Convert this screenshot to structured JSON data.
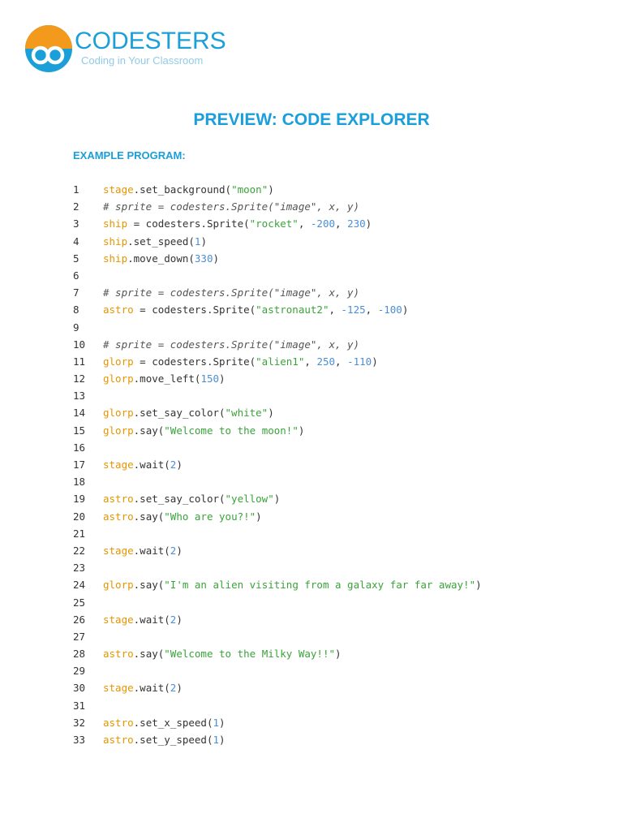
{
  "header": {
    "brand_name": "CODESTERS",
    "brand_tagline": "Coding in Your Classroom",
    "brand_colors": {
      "blue": "#1a9fd8",
      "orange": "#f39a1d"
    }
  },
  "document": {
    "title": "PREVIEW: CODE EXPLORER",
    "section_heading": "EXAMPLE PROGRAM:"
  },
  "code": {
    "colors": {
      "object": "#e59500",
      "string": "#3aa33a",
      "number": "#4a8fd6",
      "comment": "#555555",
      "plain": "#333333"
    },
    "lines": [
      {
        "num": "1",
        "tokens": [
          {
            "t": "stage",
            "c": "obj"
          },
          {
            "t": ".set_background(",
            "c": "plain"
          },
          {
            "t": "\"moon\"",
            "c": "str"
          },
          {
            "t": ")",
            "c": "plain"
          }
        ]
      },
      {
        "num": "2",
        "tokens": [
          {
            "t": "# sprite = codesters.Sprite(\"image\", x, y)",
            "c": "cmt"
          }
        ]
      },
      {
        "num": "3",
        "tokens": [
          {
            "t": "ship",
            "c": "obj"
          },
          {
            "t": " = codesters.Sprite(",
            "c": "plain"
          },
          {
            "t": "\"rocket\"",
            "c": "str"
          },
          {
            "t": ", ",
            "c": "plain"
          },
          {
            "t": "-200",
            "c": "num"
          },
          {
            "t": ", ",
            "c": "plain"
          },
          {
            "t": "230",
            "c": "num"
          },
          {
            "t": ")",
            "c": "plain"
          }
        ]
      },
      {
        "num": "4",
        "tokens": [
          {
            "t": "ship",
            "c": "obj"
          },
          {
            "t": ".set_speed(",
            "c": "plain"
          },
          {
            "t": "1",
            "c": "num"
          },
          {
            "t": ")",
            "c": "plain"
          }
        ]
      },
      {
        "num": "5",
        "tokens": [
          {
            "t": "ship",
            "c": "obj"
          },
          {
            "t": ".move_down(",
            "c": "plain"
          },
          {
            "t": "330",
            "c": "num"
          },
          {
            "t": ")",
            "c": "plain"
          }
        ]
      },
      {
        "num": "6",
        "tokens": []
      },
      {
        "num": "7",
        "tokens": [
          {
            "t": "# sprite = codesters.Sprite(\"image\", x, y)",
            "c": "cmt"
          }
        ]
      },
      {
        "num": "8",
        "tokens": [
          {
            "t": "astro",
            "c": "obj"
          },
          {
            "t": " = codesters.Sprite(",
            "c": "plain"
          },
          {
            "t": "\"astronaut2\"",
            "c": "str"
          },
          {
            "t": ", ",
            "c": "plain"
          },
          {
            "t": "-125",
            "c": "num"
          },
          {
            "t": ", ",
            "c": "plain"
          },
          {
            "t": "-100",
            "c": "num"
          },
          {
            "t": ")",
            "c": "plain"
          }
        ]
      },
      {
        "num": "9",
        "tokens": []
      },
      {
        "num": "10",
        "tokens": [
          {
            "t": "# sprite = codesters.Sprite(\"image\", x, y)",
            "c": "cmt"
          }
        ]
      },
      {
        "num": "11",
        "tokens": [
          {
            "t": "glorp",
            "c": "obj"
          },
          {
            "t": " = codesters.Sprite(",
            "c": "plain"
          },
          {
            "t": "\"alien1\"",
            "c": "str"
          },
          {
            "t": ", ",
            "c": "plain"
          },
          {
            "t": "250",
            "c": "num"
          },
          {
            "t": ", ",
            "c": "plain"
          },
          {
            "t": "-110",
            "c": "num"
          },
          {
            "t": ")",
            "c": "plain"
          }
        ]
      },
      {
        "num": "12",
        "tokens": [
          {
            "t": "glorp",
            "c": "obj"
          },
          {
            "t": ".move_left(",
            "c": "plain"
          },
          {
            "t": "150",
            "c": "num"
          },
          {
            "t": ")",
            "c": "plain"
          }
        ]
      },
      {
        "num": "13",
        "tokens": []
      },
      {
        "num": "14",
        "tokens": [
          {
            "t": "glorp",
            "c": "obj"
          },
          {
            "t": ".set_say_color(",
            "c": "plain"
          },
          {
            "t": "\"white\"",
            "c": "str"
          },
          {
            "t": ")",
            "c": "plain"
          }
        ]
      },
      {
        "num": "15",
        "tokens": [
          {
            "t": "glorp",
            "c": "obj"
          },
          {
            "t": ".say(",
            "c": "plain"
          },
          {
            "t": "\"Welcome to the moon!\"",
            "c": "str"
          },
          {
            "t": ")",
            "c": "plain"
          }
        ]
      },
      {
        "num": "16",
        "tokens": []
      },
      {
        "num": "17",
        "tokens": [
          {
            "t": "stage",
            "c": "obj"
          },
          {
            "t": ".wait(",
            "c": "plain"
          },
          {
            "t": "2",
            "c": "num"
          },
          {
            "t": ")",
            "c": "plain"
          }
        ]
      },
      {
        "num": "18",
        "tokens": []
      },
      {
        "num": "19",
        "tokens": [
          {
            "t": "astro",
            "c": "obj"
          },
          {
            "t": ".set_say_color(",
            "c": "plain"
          },
          {
            "t": "\"yellow\"",
            "c": "str"
          },
          {
            "t": ")",
            "c": "plain"
          }
        ]
      },
      {
        "num": "20",
        "tokens": [
          {
            "t": "astro",
            "c": "obj"
          },
          {
            "t": ".say(",
            "c": "plain"
          },
          {
            "t": "\"Who are you?!\"",
            "c": "str"
          },
          {
            "t": ")",
            "c": "plain"
          }
        ]
      },
      {
        "num": "21",
        "tokens": []
      },
      {
        "num": "22",
        "tokens": [
          {
            "t": "stage",
            "c": "obj"
          },
          {
            "t": ".wait(",
            "c": "plain"
          },
          {
            "t": "2",
            "c": "num"
          },
          {
            "t": ")",
            "c": "plain"
          }
        ]
      },
      {
        "num": "23",
        "tokens": []
      },
      {
        "num": "24",
        "tokens": [
          {
            "t": "glorp",
            "c": "obj"
          },
          {
            "t": ".say(",
            "c": "plain"
          },
          {
            "t": "\"I'm an alien visiting from a galaxy far far away!\"",
            "c": "str"
          },
          {
            "t": ")",
            "c": "plain"
          }
        ]
      },
      {
        "num": "25",
        "tokens": []
      },
      {
        "num": "26",
        "tokens": [
          {
            "t": "stage",
            "c": "obj"
          },
          {
            "t": ".wait(",
            "c": "plain"
          },
          {
            "t": "2",
            "c": "num"
          },
          {
            "t": ")",
            "c": "plain"
          }
        ]
      },
      {
        "num": "27",
        "tokens": []
      },
      {
        "num": "28",
        "tokens": [
          {
            "t": "astro",
            "c": "obj"
          },
          {
            "t": ".say(",
            "c": "plain"
          },
          {
            "t": "\"Welcome to the Milky Way!!\"",
            "c": "str"
          },
          {
            "t": ")",
            "c": "plain"
          }
        ]
      },
      {
        "num": "29",
        "tokens": []
      },
      {
        "num": "30",
        "tokens": [
          {
            "t": "stage",
            "c": "obj"
          },
          {
            "t": ".wait(",
            "c": "plain"
          },
          {
            "t": "2",
            "c": "num"
          },
          {
            "t": ")",
            "c": "plain"
          }
        ]
      },
      {
        "num": "31",
        "tokens": []
      },
      {
        "num": "32",
        "tokens": [
          {
            "t": "astro",
            "c": "obj"
          },
          {
            "t": ".set_x_speed(",
            "c": "plain"
          },
          {
            "t": "1",
            "c": "num"
          },
          {
            "t": ")",
            "c": "plain"
          }
        ]
      },
      {
        "num": "33",
        "tokens": [
          {
            "t": "astro",
            "c": "obj"
          },
          {
            "t": ".set_y_speed(",
            "c": "plain"
          },
          {
            "t": "1",
            "c": "num"
          },
          {
            "t": ")",
            "c": "plain"
          }
        ]
      }
    ]
  }
}
